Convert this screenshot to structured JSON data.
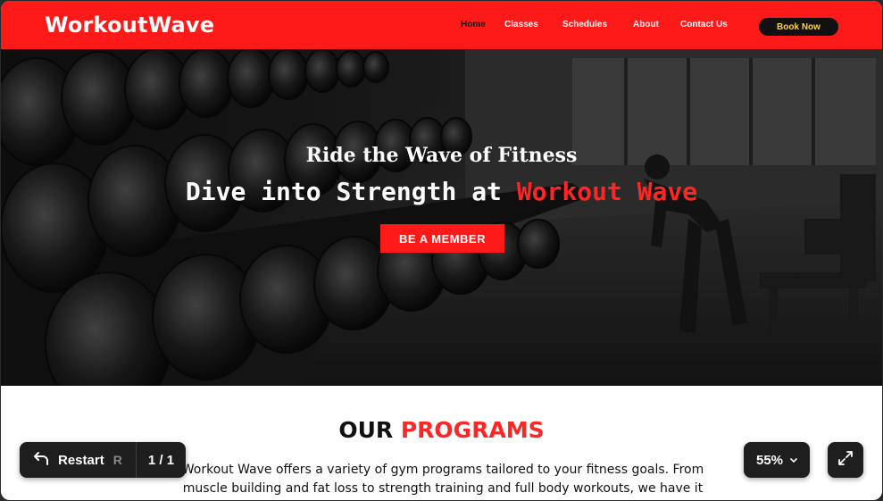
{
  "navbar": {
    "brand": "WorkoutWave",
    "links": [
      "Home",
      "Classes",
      "Schedules",
      "About",
      "Contact Us"
    ],
    "active": "Home",
    "cta": "Book Now",
    "colors": {
      "bar": "#ff1a1a",
      "cta_bg": "#111111",
      "cta_text": "#ffd23a"
    }
  },
  "hero": {
    "subtitle": "Ride the Wave of Fitness",
    "title_prefix": "Dive into Strength at ",
    "title_accent": "Workout Wave",
    "button": "BE A MEMBER",
    "background": "gym dumbbell rack photo"
  },
  "programs": {
    "title_prefix": "OUR ",
    "title_accent": "PROGRAMS",
    "description": "Workout Wave offers a variety of gym programs tailored to your fitness goals. From muscle building and fat loss to strength training and full body workouts, we have it"
  },
  "controls": {
    "restart_label": "Restart",
    "restart_shortcut": "R",
    "page_indicator": "1 / 1",
    "zoom": "55%",
    "icons": [
      "undo-arrow-icon",
      "chevron-down-icon",
      "expand-icon"
    ]
  },
  "accent_color": "#ff2626"
}
